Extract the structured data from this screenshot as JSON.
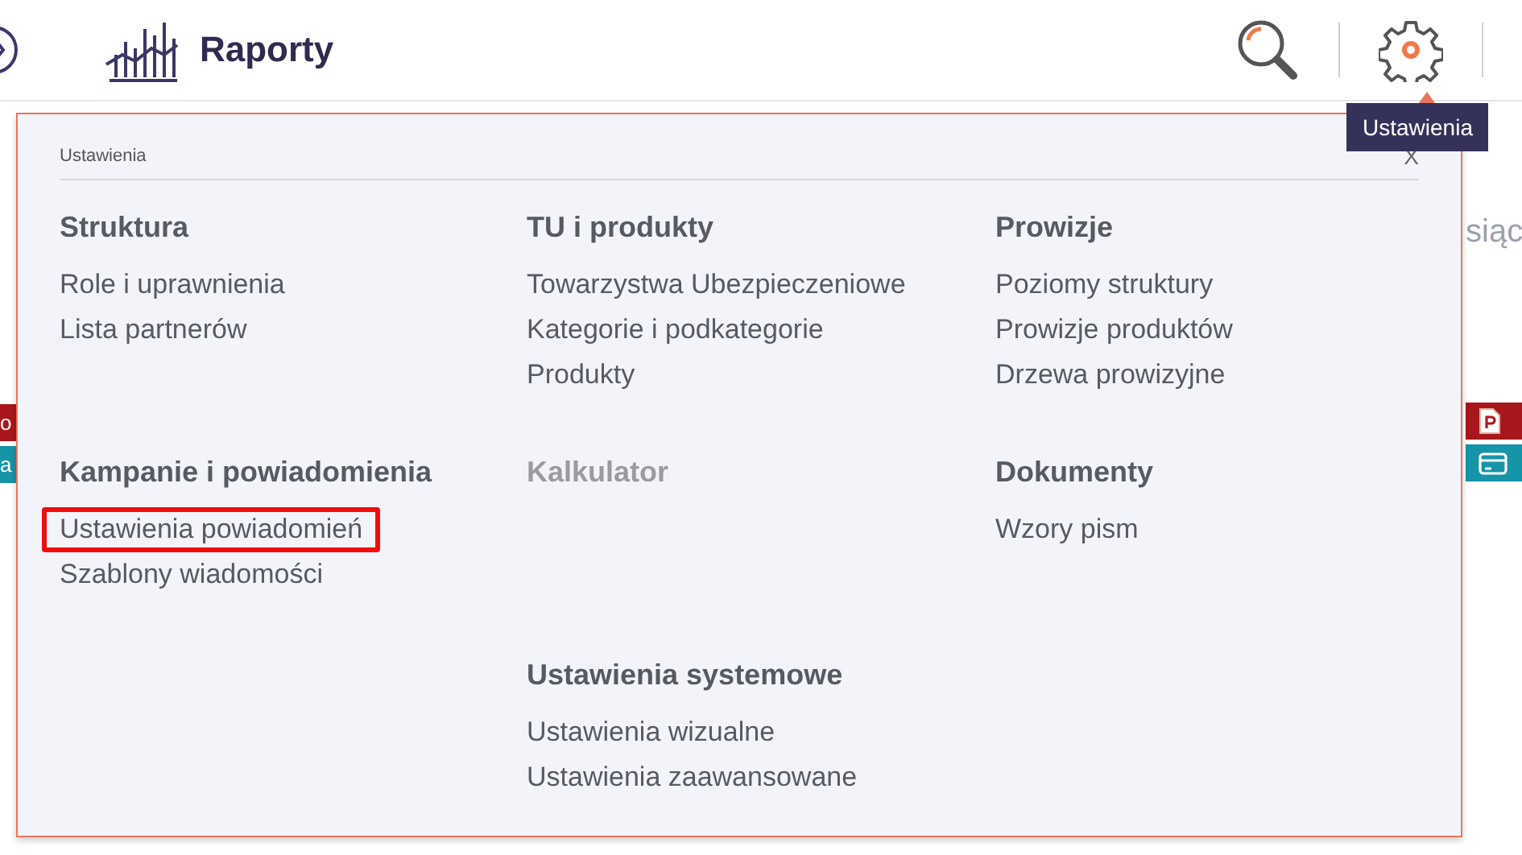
{
  "header": {
    "title": "Raporty"
  },
  "tooltip": {
    "text": "Ustawienia"
  },
  "background": {
    "left_labels": [
      "o",
      "a"
    ],
    "right_text": "siąc"
  },
  "settings_panel": {
    "title": "Ustawienia",
    "close": "X",
    "rows": [
      {
        "columns": [
          {
            "sections": [
              {
                "heading": "Struktura",
                "disabled": false,
                "items": [
                  {
                    "label": "Role i uprawnienia",
                    "highlighted": false
                  },
                  {
                    "label": "Lista partnerów",
                    "highlighted": false
                  }
                ]
              }
            ]
          },
          {
            "sections": [
              {
                "heading": "TU i produkty",
                "disabled": false,
                "items": [
                  {
                    "label": "Towarzystwa Ubezpieczeniowe",
                    "highlighted": false
                  },
                  {
                    "label": "Kategorie i podkategorie",
                    "highlighted": false
                  },
                  {
                    "label": "Produkty",
                    "highlighted": false
                  }
                ]
              }
            ]
          },
          {
            "sections": [
              {
                "heading": "Prowizje",
                "disabled": false,
                "items": [
                  {
                    "label": "Poziomy struktury",
                    "highlighted": false
                  },
                  {
                    "label": "Prowizje produktów",
                    "highlighted": false
                  },
                  {
                    "label": "Drzewa prowizyjne",
                    "highlighted": false
                  }
                ]
              }
            ]
          }
        ]
      },
      {
        "columns": [
          {
            "sections": [
              {
                "heading": "Kampanie i powiadomienia",
                "disabled": false,
                "items": [
                  {
                    "label": "Ustawienia powiadomień",
                    "highlighted": true
                  },
                  {
                    "label": "Szablony wiadomości",
                    "highlighted": false
                  }
                ]
              }
            ]
          },
          {
            "sections": [
              {
                "heading": "Kalkulator",
                "disabled": true
              },
              {
                "heading": "Ustawienia systemowe",
                "disabled": false,
                "items": [
                  {
                    "label": "Ustawienia wizualne",
                    "highlighted": false
                  },
                  {
                    "label": "Ustawienia zaawansowane",
                    "highlighted": false
                  }
                ]
              }
            ]
          },
          {
            "sections": [
              {
                "heading": "Dokumenty",
                "disabled": false,
                "items": [
                  {
                    "label": "Wzory pism",
                    "highlighted": false
                  }
                ]
              }
            ]
          }
        ]
      }
    ]
  }
}
